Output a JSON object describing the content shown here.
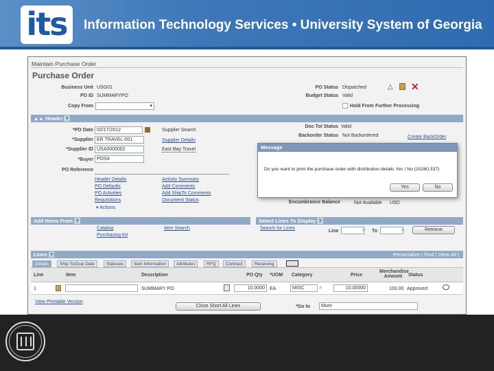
{
  "banner": {
    "logo_text": "its",
    "title": "Information Technology Services  •  University System of Georgia"
  },
  "window": {
    "crumb": "Maintain Purchase Order",
    "title": "Purchase Order",
    "bu_label": "Business Unit",
    "bu_value": "USG01",
    "poid_label": "PO ID",
    "poid_value": "SUMMARYPO",
    "copyfrom_label": "Copy From",
    "postatus_label": "PO Status",
    "postatus_value": "Dispatched",
    "budget_label": "Budget Status",
    "budget_value": "Valid",
    "hold_label": "Hold From Further Processing"
  },
  "header": {
    "bar_label": "Header",
    "podate_label": "*PO Date",
    "podate_value": "02/17/2012",
    "supplier_label": "*Supplier",
    "supplier_value": "ER TRAVEL-001",
    "supplierid_label": "*Supplier ID",
    "supplierid_value": "USA0000002",
    "buyer_label": "*Buyer",
    "buyer_value": "POS4",
    "supsearch": "Supplier Search",
    "supdetails": "Supplier Details",
    "supname": "East Bay Travel",
    "poref_label": "PO Reference",
    "links_left": [
      "Header Details",
      "PO Defaults",
      "PO Activities",
      "Requisitions"
    ],
    "actions_label": "▾ Actions",
    "links_right": [
      "Activity Summary",
      "Add Comments",
      "Add ShipTo Comments",
      "Document Status"
    ],
    "doctol_label": "Doc Tol Status",
    "doctol_value": "Valid",
    "backorder_label": "Backorder Status",
    "backorder_value": "Not Backordered",
    "create_backorder": "Create BackOrder",
    "enc_label": "Encumbrance Balance",
    "enc_value": "Not Available",
    "enc_currency": "USD"
  },
  "additems": {
    "bar_label": "Add Items From",
    "catalog": "Catalog",
    "purchasing_kit": "Purchasing Kit",
    "item_search": "Item Search"
  },
  "selectlines": {
    "bar_label": "Select Lines To Display",
    "search": "Search for Lines",
    "line_label": "Line",
    "to_label": "To",
    "retrieve": "Retrieve"
  },
  "lines": {
    "bar_label": "Lines",
    "nav": "Personalize | Find | View All |",
    "tabs": [
      "Details",
      "Ship To/Due Date",
      "Statuses",
      "Item Information",
      "Attributes",
      "RFQ",
      "Contract",
      "Receiving"
    ],
    "headers": {
      "line": "Line",
      "item": "Item",
      "desc": "Description",
      "qty": "PO Qty",
      "uom": "*UOM",
      "cat": "Category",
      "price": "Price",
      "merch": "Merchandise Amount",
      "status": "Status"
    },
    "row": {
      "line": "1",
      "desc": "SUMMARY PO",
      "qty": "10.0000",
      "uom": "EA",
      "cat": "MISC",
      "price": "10.00000",
      "merch": "100.00",
      "status": "Approved"
    }
  },
  "footer": {
    "printable": "View Printable Version",
    "close_short": "Close Short All Lines",
    "goto_label": "*Go to",
    "goto_value": "More"
  },
  "message": {
    "title": "Message",
    "text": "Do you want to print the purchase order with distribution details Yes / No (10260,337)",
    "yes": "Yes",
    "no": "No"
  }
}
